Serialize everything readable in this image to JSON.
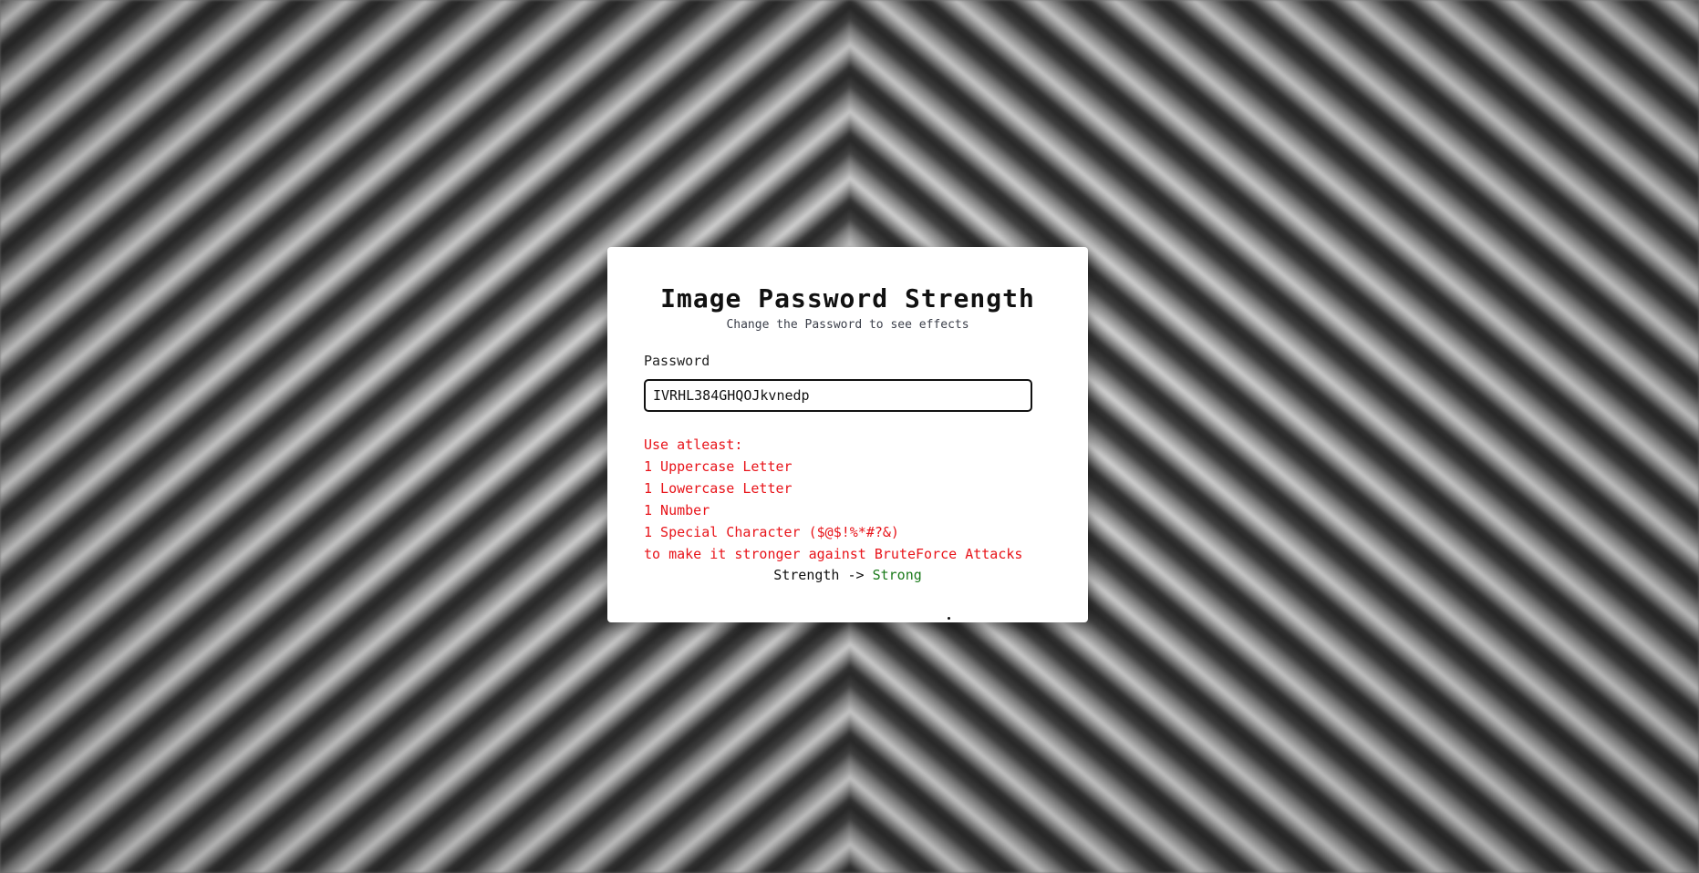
{
  "page": {
    "title": "Image Password Strength",
    "subtitle": "Change the Password to see effects"
  },
  "form": {
    "password_label": "Password",
    "password_value": "IVRHL384GHQOJkvnedp"
  },
  "rules": {
    "intro": "Use atleast:",
    "items": [
      "1 Uppercase Letter",
      "1 Lowercase Letter",
      "1 Number",
      "1 Special Character ($@$!%*#?&)"
    ],
    "outro": "to make it stronger against BruteForce Attacks"
  },
  "strength": {
    "label": "Strength ->",
    "value": "Strong"
  },
  "colors": {
    "rules_text": "#e8141a",
    "strength_value": "#1a7a1a",
    "card_background": "#ffffff"
  }
}
